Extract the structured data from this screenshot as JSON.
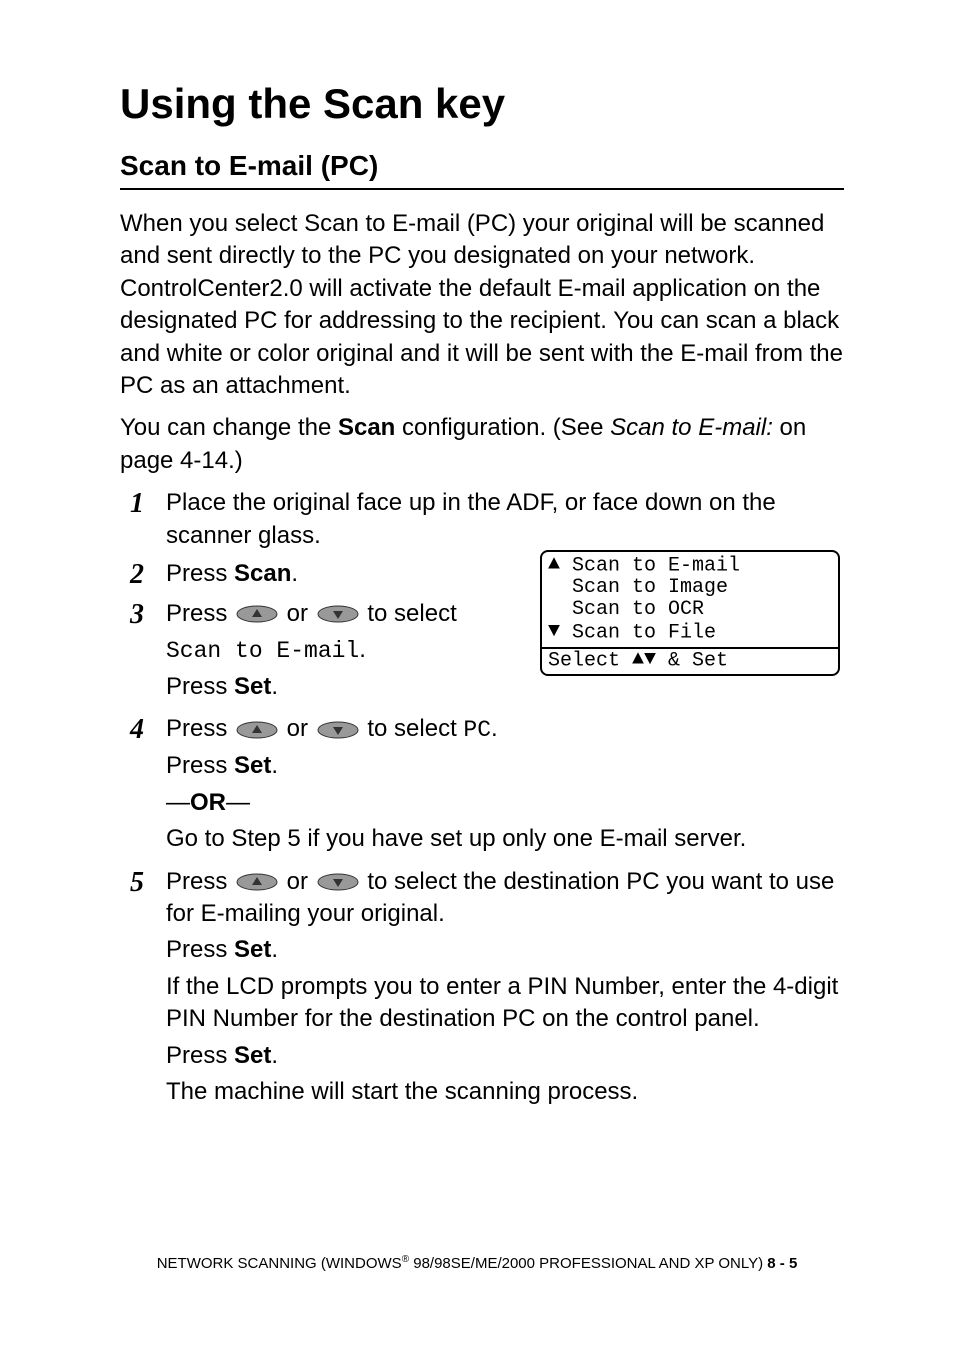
{
  "title": "Using the Scan key",
  "subtitle": "Scan to E-mail (PC)",
  "intro1": "When you select Scan to E-mail (PC) your original will be scanned and sent directly to the PC you designated on your network. ControlCenter2.0 will activate the default E-mail application on the designated PC for addressing to the recipient. You can scan a black and white or color original and it will be sent with the E-mail from the PC as an attachment.",
  "intro2_pre": "You can change the ",
  "intro2_bold": "Scan",
  "intro2_mid": " configuration. (See ",
  "intro2_link": "Scan to E-mail:",
  "intro2_post": " on page 4-14.)",
  "steps": {
    "s1": {
      "num": "1",
      "text": "Place the original face up in the ADF, or face down on the scanner glass."
    },
    "s2": {
      "num": "2",
      "pre": "Press ",
      "bold": "Scan",
      "post": "."
    },
    "s3": {
      "num": "3",
      "l1_pre": "Press ",
      "l1_mid": " or ",
      "l1_post": " to select",
      "l2_mono": "Scan to E-mail",
      "l2_post": ".",
      "l3_pre": "Press ",
      "l3_bold": "Set",
      "l3_post": "."
    },
    "s4": {
      "num": "4",
      "l1_pre": "Press ",
      "l1_mid": " or ",
      "l1_post": " to select ",
      "l1_mono": "PC",
      "l1_end": ".",
      "l2_pre": "Press ",
      "l2_bold": "Set",
      "l2_post": ".",
      "or_dash1": "—",
      "or_text": "OR",
      "or_dash2": "—",
      "l3": "Go to Step 5 if you have set up only one E-mail server."
    },
    "s5": {
      "num": "5",
      "l1_pre": "Press ",
      "l1_mid": " or ",
      "l1_post": " to select the destination PC you want to use for E-mailing your original.",
      "l2_pre": "Press ",
      "l2_bold": "Set",
      "l2_post": ".",
      "l3": "If the LCD prompts you to enter a PIN Number, enter the 4-digit PIN Number for the destination PC on the control panel.",
      "l4_pre": "Press ",
      "l4_bold": "Set",
      "l4_post": ".",
      "l5": "The machine will start the scanning process."
    }
  },
  "lcd": {
    "r1": "Scan to E-mail",
    "r2": "Scan to Image",
    "r3": "Scan to OCR",
    "r4": "Scan to File",
    "bottom_pre": "Select ",
    "bottom_post": " & Set"
  },
  "footer": {
    "pre": "NETWORK SCANNING (WINDOWS",
    "reg": "®",
    "mid": " 98/98SE/ME/2000 PROFESSIONAL AND XP ONLY)   ",
    "page": "8 - 5"
  }
}
